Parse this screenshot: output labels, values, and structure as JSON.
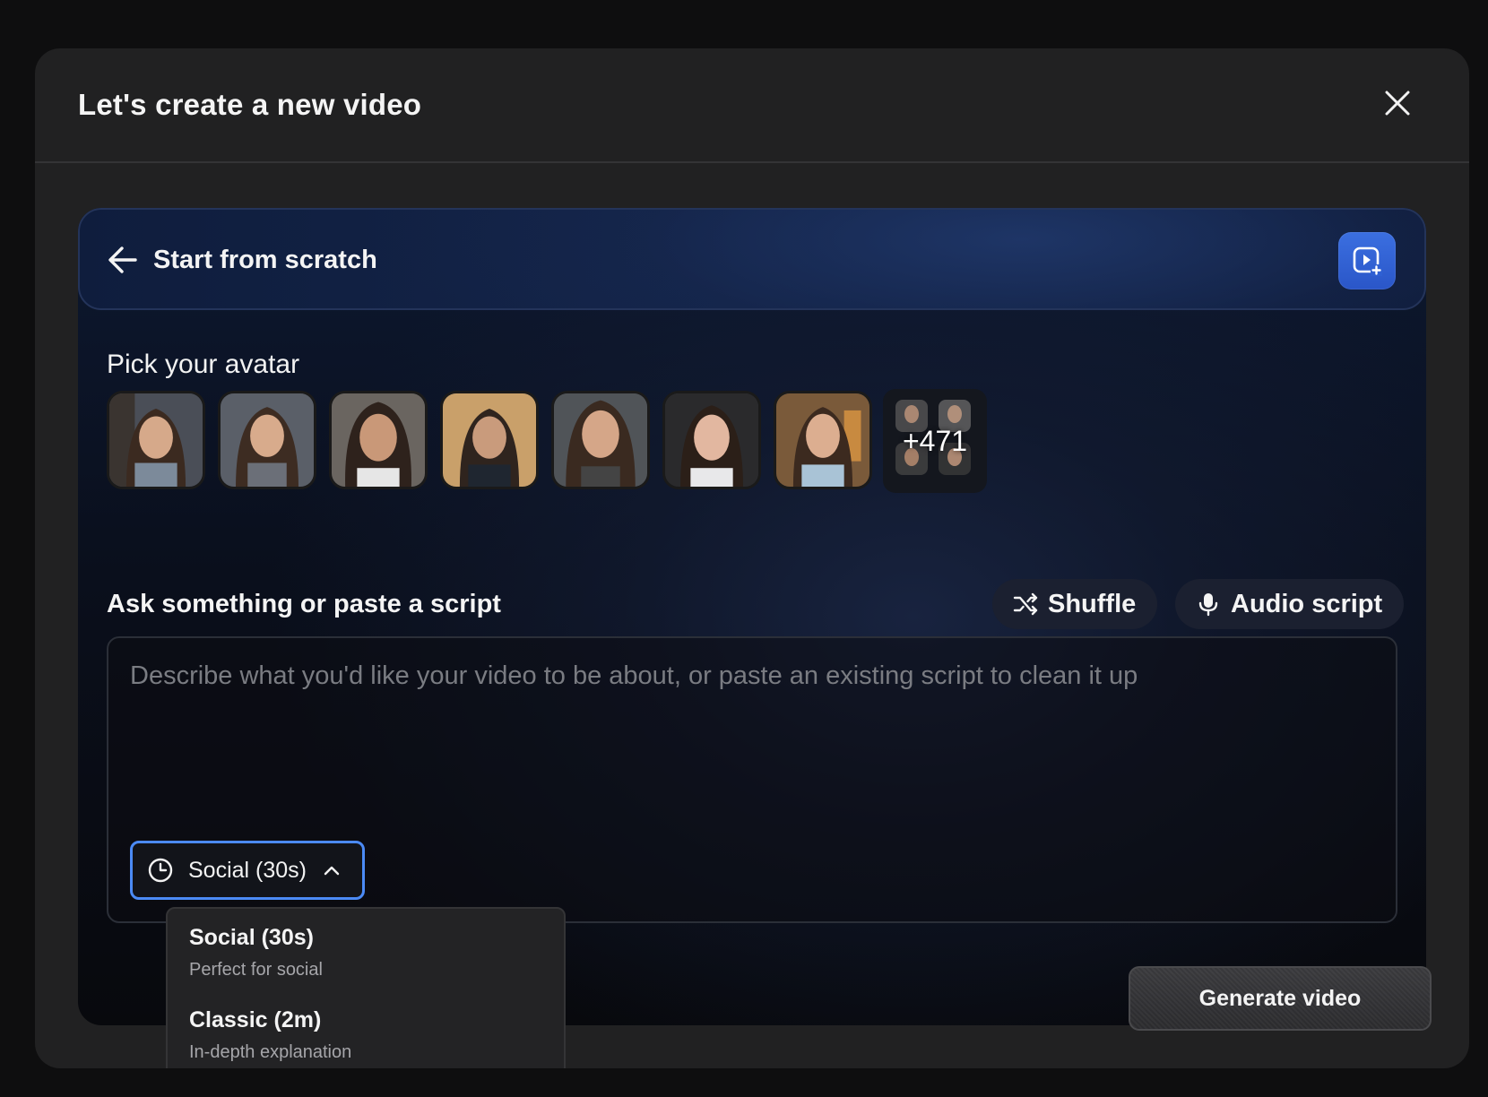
{
  "modal": {
    "title": "Let's create a new video"
  },
  "scratch": {
    "title": "Start from scratch"
  },
  "avatars": {
    "label": "Pick your avatar",
    "more_count": "+471"
  },
  "script": {
    "label": "Ask something or paste a script",
    "placeholder": "Describe what you'd like your video to be about, or paste an existing script to clean it up",
    "shuffle_label": "Shuffle",
    "audio_label": "Audio script"
  },
  "duration": {
    "selected": "Social (30s)",
    "options": [
      {
        "title": "Social (30s)",
        "subtitle": "Perfect for social"
      },
      {
        "title": "Classic (2m)",
        "subtitle": "In-depth explanation"
      }
    ]
  },
  "actions": {
    "generate_label": "Generate video"
  },
  "colors": {
    "accent": "#4b8af5",
    "primary_button": "#3b6fe0",
    "modal_bg": "#212122"
  }
}
